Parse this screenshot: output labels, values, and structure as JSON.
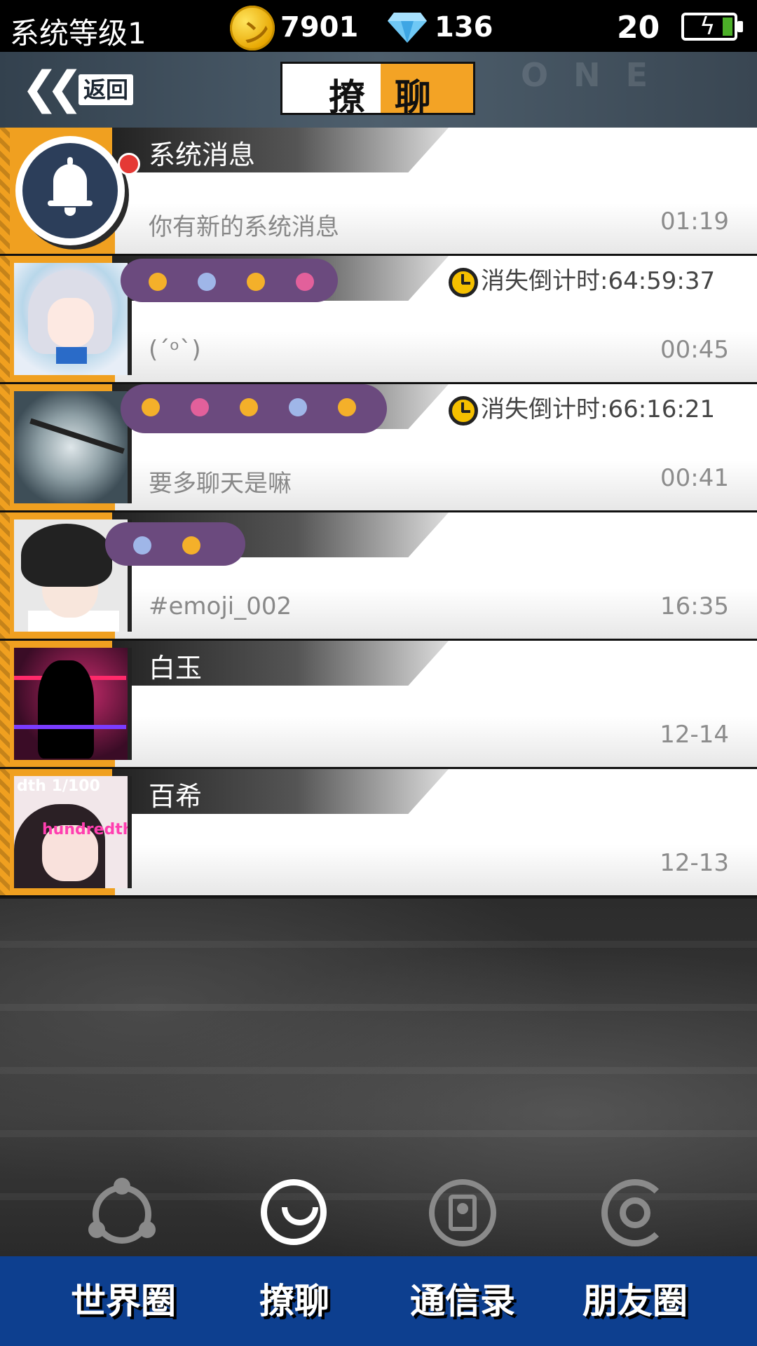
{
  "status": {
    "level": "系统等级1",
    "coins": "7901",
    "gems": "136",
    "time": "20"
  },
  "header": {
    "back": "返回",
    "title_part1": "撩",
    "title_part2": "聊",
    "deco": "ONE"
  },
  "chats": [
    {
      "name": "系统消息",
      "preview": "你有新的系统消息",
      "time": "01:19",
      "timer": ""
    },
    {
      "name": "",
      "preview": "(ˊᵒˋ)",
      "time": "00:45",
      "timer": "消失倒计时:64:59:37"
    },
    {
      "name": "",
      "preview": "要多聊天是嘛",
      "time": "00:41",
      "timer": "消失倒计时:66:16:21"
    },
    {
      "name": "",
      "preview": "#emoji_002",
      "time": "16:35",
      "timer": ""
    },
    {
      "name": "白玉",
      "preview": "",
      "time": "12-14",
      "timer": ""
    },
    {
      "name": "百希",
      "preview": "",
      "time": "12-13",
      "timer": ""
    }
  ],
  "avatar_text": {
    "hundredth_1": "dth 1/100",
    "hundredth_2": "hundredth"
  },
  "tabs": [
    "世界圈",
    "撩聊",
    "通信录",
    "朋友圈"
  ],
  "icons": {
    "coin": "coin-icon",
    "gem": "diamond-icon",
    "battery": "battery-charging-icon",
    "back": "double-chevron-left-icon",
    "system": "bell-icon",
    "timer": "stopwatch-icon",
    "nav": [
      "world-circle-icon",
      "chat-bubble-icon",
      "contacts-book-icon",
      "moments-target-icon"
    ]
  },
  "colors": {
    "accent_orange": "#f3a325",
    "tab_bar": "#0d3f8f",
    "unread_dot": "#e53935"
  }
}
